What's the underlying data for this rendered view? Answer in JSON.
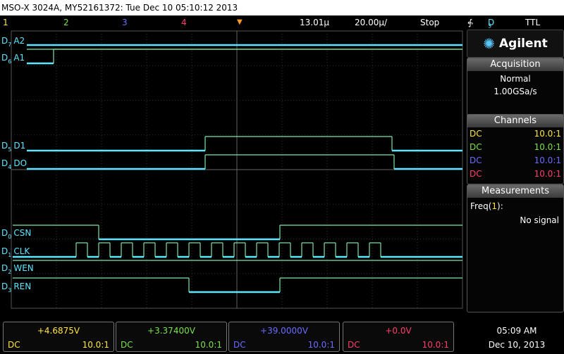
{
  "title": "MSO-X 3024A, MY52161372: Tue Dec 10 05:10:12 2013",
  "status": {
    "ch1": "1",
    "ch2": "2",
    "ch3": "3",
    "ch4": "4",
    "delay": "13.01µ",
    "timebase": "20.00µ/",
    "run_state": "Stop",
    "trigger_icon": "rising-edge-icon",
    "trigger_source": "D",
    "trigger_source_sub": "3",
    "trigger_level": "TTL"
  },
  "brand": "Agilent",
  "acquisition": {
    "header": "Acquisition",
    "mode": "Normal",
    "rate": "1.00GSa/s"
  },
  "channels": {
    "header": "Channels",
    "rows": [
      {
        "coupling": "DC",
        "probe": "10.0:1",
        "color": "#ffe63c"
      },
      {
        "coupling": "DC",
        "probe": "10.0:1",
        "color": "#7be24d"
      },
      {
        "coupling": "DC",
        "probe": "10.0:1",
        "color": "#6b6bff"
      },
      {
        "coupling": "DC",
        "probe": "10.0:1",
        "color": "#ff3e6e"
      }
    ]
  },
  "measurements": {
    "header": "Measurements",
    "label": "Freq(",
    "channel": "1",
    "label_end": "):",
    "value": "No signal"
  },
  "bottom": [
    {
      "offset": "+4.6875V",
      "coupling": "DC",
      "probe": "10.0:1",
      "color": "#ffe63c"
    },
    {
      "offset": "+3.37400V",
      "coupling": "DC",
      "probe": "10.0:1",
      "color": "#7be24d"
    },
    {
      "offset": "+39.0000V",
      "coupling": "DC",
      "probe": "10.0:1",
      "color": "#6b6bff"
    },
    {
      "offset": "+0.0V",
      "coupling": "DC",
      "probe": "10.0:1",
      "color": "#ff3e6e"
    }
  ],
  "clock": {
    "time": "05:09 AM",
    "date": "Dec 10, 2013"
  },
  "digital_labels": [
    {
      "ch": "D",
      "sub": "7",
      "name": "A2"
    },
    {
      "ch": "D",
      "sub": "6",
      "name": "A1"
    },
    {
      "ch": "D",
      "sub": "5",
      "name": "D1"
    },
    {
      "ch": "D",
      "sub": "4",
      "name": "DO"
    },
    {
      "ch": "D",
      "sub": "0",
      "name": "CSN"
    },
    {
      "ch": "D",
      "sub": "1",
      "name": "CLK"
    },
    {
      "ch": "D",
      "sub": "2",
      "name": "WEN"
    },
    {
      "ch": "D",
      "sub": "3",
      "name": "REN"
    }
  ],
  "colors": {
    "trace_high": "#5ee6ff",
    "trace_low_line": "#7de6a8",
    "grid": "#4a4a4a",
    "label": "#5ee6ff"
  }
}
